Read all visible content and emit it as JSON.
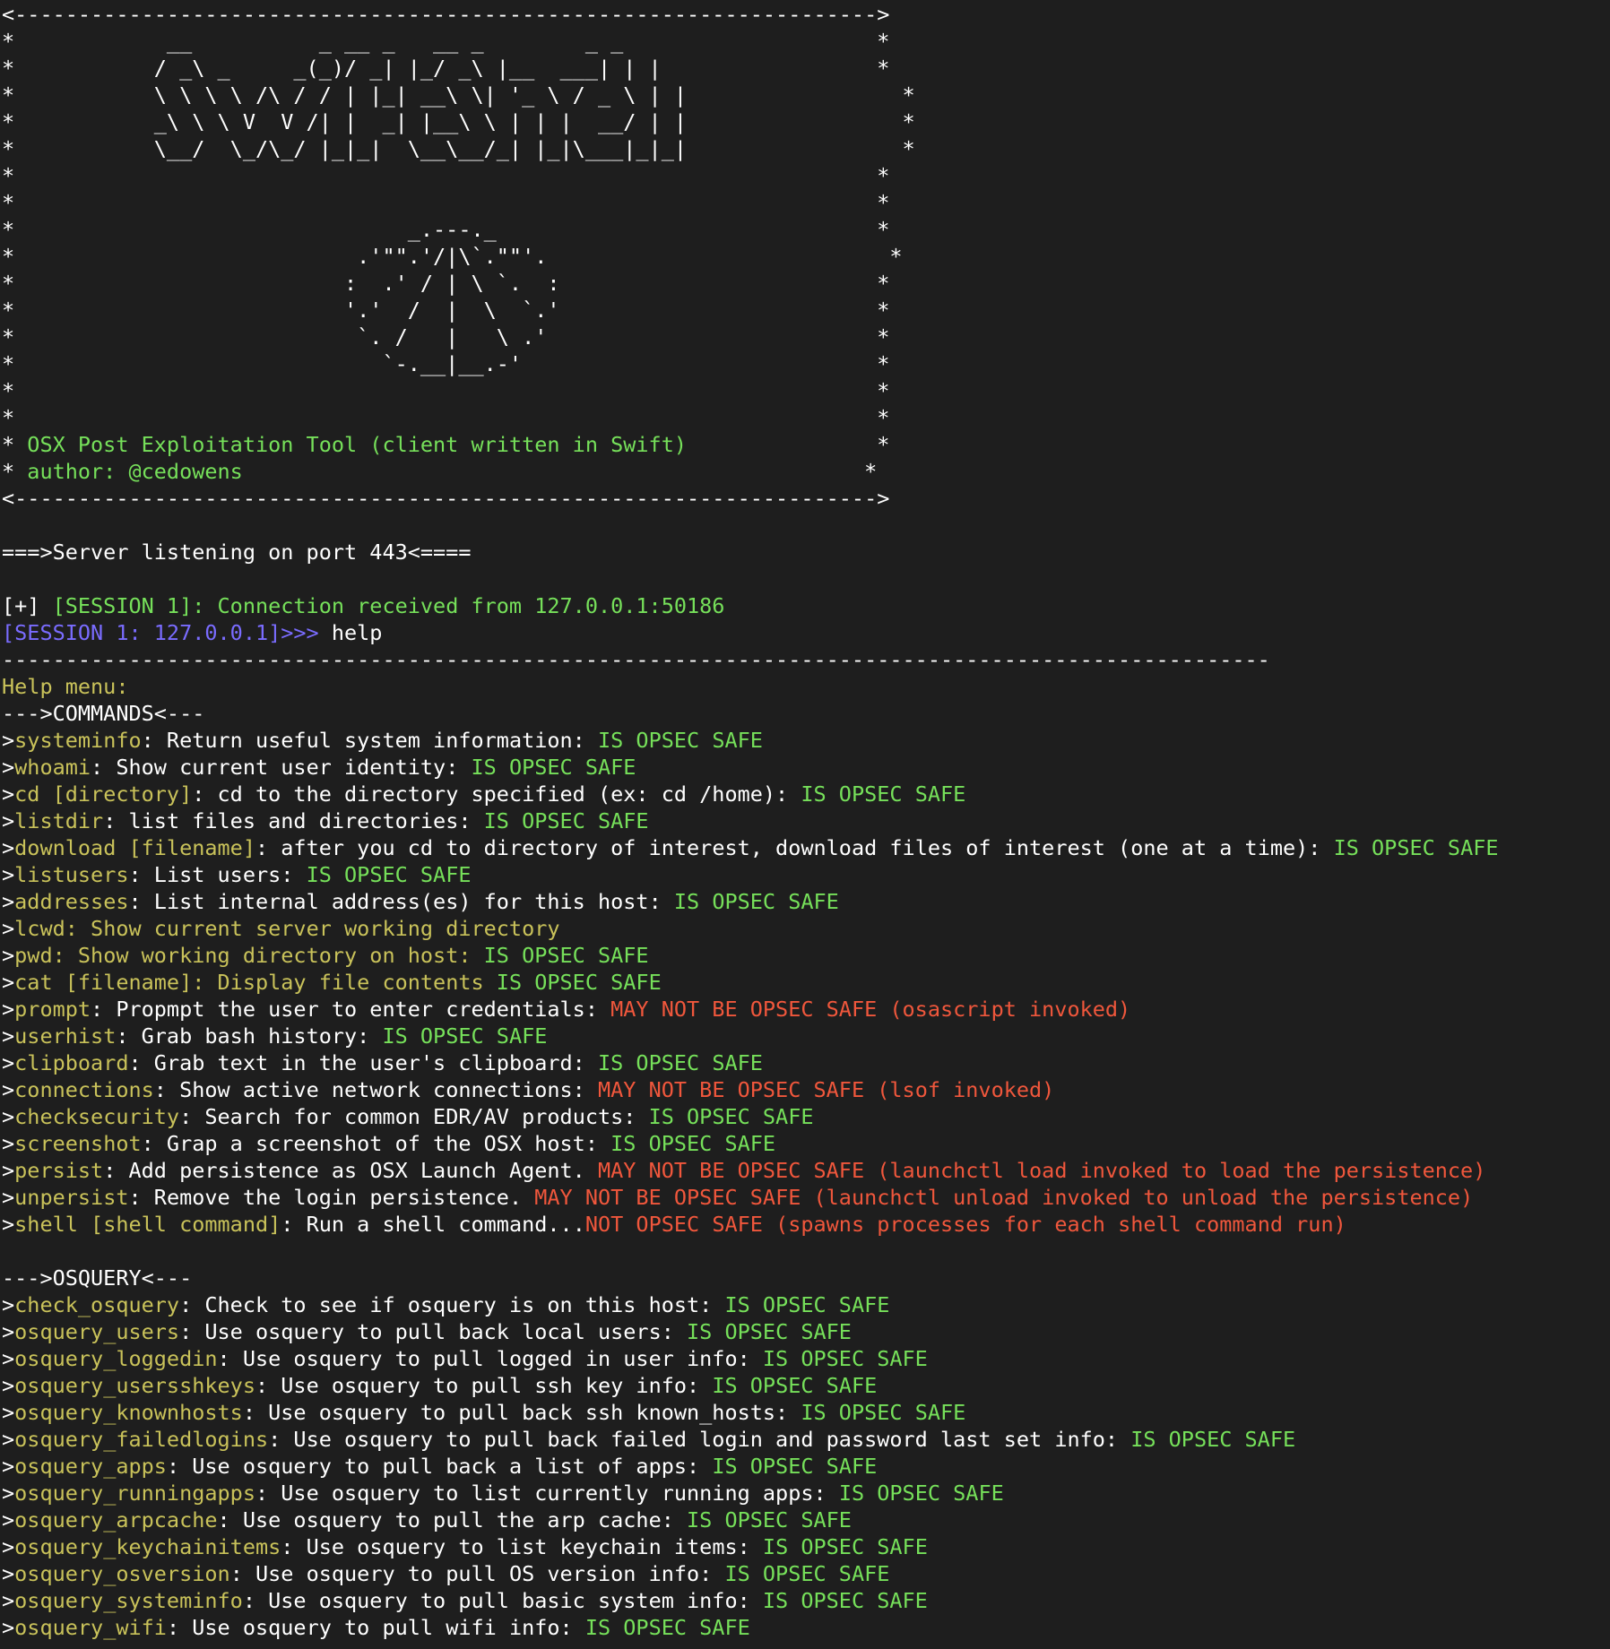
{
  "colors": {
    "background": "#1e1e1e",
    "w": "#ffffff",
    "g": "#76e05a",
    "y": "#c9c25a",
    "r": "#f0573c",
    "b": "#7a6cff"
  },
  "lines": [
    [
      [
        "w",
        "<-------------------------------------------------------------------->"
      ]
    ],
    [
      [
        "w",
        "*            __          _ __ _   __ _        _ _                    *"
      ]
    ],
    [
      [
        "w",
        "*           / _\\ _     _(_)/ _| |_/ _\\ |__  ___| | |                 *"
      ]
    ],
    [
      [
        "w",
        "*           \\ \\ \\ \\ /\\ / / | |_| __\\ \\| '_ \\ / _ \\ | |                 *"
      ]
    ],
    [
      [
        "w",
        "*           _\\ \\ \\ V  V /| |  _| |__\\ \\ | | |  __/ | |                 *"
      ]
    ],
    [
      [
        "w",
        "*           \\__/  \\_/\\_/ |_|_|  \\__\\__/_| |_|\\___|_|_|                 *"
      ]
    ],
    [
      [
        "w",
        "*                                                                    *"
      ]
    ],
    [
      [
        "w",
        "*                                                                    *"
      ]
    ],
    [
      [
        "w",
        "*                               _.---._                              *"
      ]
    ],
    [
      [
        "w",
        "*                           .'\"\".'/|\\`.\"\"'.                           *"
      ]
    ],
    [
      [
        "w",
        "*                          :  .' / | \\ `.  :                         *"
      ]
    ],
    [
      [
        "w",
        "*                          '.'  /  |  \\  `.'                         *"
      ]
    ],
    [
      [
        "w",
        "*                           `. /   |   \\ .'                          *"
      ]
    ],
    [
      [
        "w",
        "*                             `-.__|__.-'                            *"
      ]
    ],
    [
      [
        "w",
        "*                                                                    *"
      ]
    ],
    [
      [
        "w",
        "*                                                                    *"
      ]
    ],
    [
      [
        "w",
        "* "
      ],
      [
        "g",
        "OSX Post Exploitation Tool (client written in Swift)"
      ],
      [
        "w",
        "               *"
      ]
    ],
    [
      [
        "w",
        "* "
      ],
      [
        "g",
        "author: @cedowens"
      ],
      [
        "w",
        "                                                 *"
      ]
    ],
    [
      [
        "w",
        "<-------------------------------------------------------------------->"
      ]
    ],
    [
      [
        "w",
        ""
      ]
    ],
    [
      [
        "w",
        "===>Server listening on port 443<===="
      ]
    ],
    [
      [
        "w",
        ""
      ]
    ],
    [
      [
        "w",
        "[+] "
      ],
      [
        "g",
        "[SESSION 1]: Connection received from 127.0.0.1:50186"
      ]
    ],
    [
      [
        "b",
        "[SESSION 1: 127.0.0.1]>>> "
      ],
      [
        "w",
        "help"
      ]
    ],
    [
      [
        "w",
        "----------------------------------------------------------------------------------------------------"
      ]
    ],
    [
      [
        "y",
        "Help menu:"
      ]
    ],
    [
      [
        "w",
        "--->COMMANDS<---"
      ]
    ],
    [
      [
        "w",
        ">"
      ],
      [
        "y",
        "systeminfo"
      ],
      [
        "w",
        ": Return useful system information: "
      ],
      [
        "g",
        "IS OPSEC SAFE"
      ]
    ],
    [
      [
        "w",
        ">"
      ],
      [
        "y",
        "whoami"
      ],
      [
        "w",
        ": Show current user identity: "
      ],
      [
        "g",
        "IS OPSEC SAFE"
      ]
    ],
    [
      [
        "w",
        ">"
      ],
      [
        "y",
        "cd [directory]"
      ],
      [
        "w",
        ": cd to the directory specified (ex: cd /home): "
      ],
      [
        "g",
        "IS OPSEC SAFE"
      ]
    ],
    [
      [
        "w",
        ">"
      ],
      [
        "y",
        "listdir"
      ],
      [
        "w",
        ": list files and directories: "
      ],
      [
        "g",
        "IS OPSEC SAFE"
      ]
    ],
    [
      [
        "w",
        ">"
      ],
      [
        "y",
        "download [filename]"
      ],
      [
        "w",
        ": after you cd to directory of interest, download files of interest (one at a time): "
      ],
      [
        "g",
        "IS OPSEC SAFE"
      ]
    ],
    [
      [
        "w",
        ">"
      ],
      [
        "y",
        "listusers"
      ],
      [
        "w",
        ": List users: "
      ],
      [
        "g",
        "IS OPSEC SAFE"
      ]
    ],
    [
      [
        "w",
        ">"
      ],
      [
        "y",
        "addresses"
      ],
      [
        "w",
        ": List internal address(es) for this host: "
      ],
      [
        "g",
        "IS OPSEC SAFE"
      ]
    ],
    [
      [
        "w",
        ">"
      ],
      [
        "y",
        "lcwd: Show current server working directory"
      ]
    ],
    [
      [
        "w",
        ">"
      ],
      [
        "y",
        "pwd: Show working directory on host: "
      ],
      [
        "g",
        "IS OPSEC SAFE"
      ]
    ],
    [
      [
        "w",
        ">"
      ],
      [
        "y",
        "cat [filename]: Display file contents "
      ],
      [
        "g",
        "IS OPSEC SAFE"
      ]
    ],
    [
      [
        "w",
        ">"
      ],
      [
        "y",
        "prompt"
      ],
      [
        "w",
        ": Propmpt the user to enter credentials: "
      ],
      [
        "r",
        "MAY NOT BE OPSEC SAFE (osascript invoked)"
      ]
    ],
    [
      [
        "w",
        ">"
      ],
      [
        "y",
        "userhist"
      ],
      [
        "w",
        ": Grab bash history: "
      ],
      [
        "g",
        "IS OPSEC SAFE"
      ]
    ],
    [
      [
        "w",
        ">"
      ],
      [
        "y",
        "clipboard"
      ],
      [
        "w",
        ": Grab text in the user's clipboard: "
      ],
      [
        "g",
        "IS OPSEC SAFE"
      ]
    ],
    [
      [
        "w",
        ">"
      ],
      [
        "y",
        "connections"
      ],
      [
        "w",
        ": Show active network connections: "
      ],
      [
        "r",
        "MAY NOT BE OPSEC SAFE (lsof invoked)"
      ]
    ],
    [
      [
        "w",
        ">"
      ],
      [
        "y",
        "checksecurity"
      ],
      [
        "w",
        ": Search for common EDR/AV products: "
      ],
      [
        "g",
        "IS OPSEC SAFE"
      ]
    ],
    [
      [
        "w",
        ">"
      ],
      [
        "y",
        "screenshot"
      ],
      [
        "w",
        ": Grap a screenshot of the OSX host: "
      ],
      [
        "g",
        "IS OPSEC SAFE"
      ]
    ],
    [
      [
        "w",
        ">"
      ],
      [
        "y",
        "persist"
      ],
      [
        "w",
        ": Add persistence as OSX Launch Agent. "
      ],
      [
        "r",
        "MAY NOT BE OPSEC SAFE (launchctl load invoked to load the persistence)"
      ]
    ],
    [
      [
        "w",
        ">"
      ],
      [
        "y",
        "unpersist"
      ],
      [
        "w",
        ": Remove the login persistence. "
      ],
      [
        "r",
        "MAY NOT BE OPSEC SAFE (launchctl unload invoked to unload the persistence)"
      ]
    ],
    [
      [
        "w",
        ">"
      ],
      [
        "y",
        "shell [shell command]"
      ],
      [
        "w",
        ": Run a shell command..."
      ],
      [
        "r",
        "NOT OPSEC SAFE (spawns processes for each shell command run)"
      ]
    ],
    [
      [
        "w",
        ""
      ]
    ],
    [
      [
        "w",
        "--->OSQUERY<---"
      ]
    ],
    [
      [
        "w",
        ">"
      ],
      [
        "y",
        "check_osquery"
      ],
      [
        "w",
        ": Check to see if osquery is on this host: "
      ],
      [
        "g",
        "IS OPSEC SAFE"
      ]
    ],
    [
      [
        "w",
        ">"
      ],
      [
        "y",
        "osquery_users"
      ],
      [
        "w",
        ": Use osquery to pull back local users: "
      ],
      [
        "g",
        "IS OPSEC SAFE"
      ]
    ],
    [
      [
        "w",
        ">"
      ],
      [
        "y",
        "osquery_loggedin"
      ],
      [
        "w",
        ": Use osquery to pull logged in user info: "
      ],
      [
        "g",
        "IS OPSEC SAFE"
      ]
    ],
    [
      [
        "w",
        ">"
      ],
      [
        "y",
        "osquery_usersshkeys"
      ],
      [
        "w",
        ": Use osquery to pull ssh key info: "
      ],
      [
        "g",
        "IS OPSEC SAFE"
      ]
    ],
    [
      [
        "w",
        ">"
      ],
      [
        "y",
        "osquery_knownhosts"
      ],
      [
        "w",
        ": Use osquery to pull back ssh known_hosts: "
      ],
      [
        "g",
        "IS OPSEC SAFE"
      ]
    ],
    [
      [
        "w",
        ">"
      ],
      [
        "y",
        "osquery_failedlogins"
      ],
      [
        "w",
        ": Use osquery to pull back failed login and password last set info: "
      ],
      [
        "g",
        "IS OPSEC SAFE"
      ]
    ],
    [
      [
        "w",
        ">"
      ],
      [
        "y",
        "osquery_apps"
      ],
      [
        "w",
        ": Use osquery to pull back a list of apps: "
      ],
      [
        "g",
        "IS OPSEC SAFE"
      ]
    ],
    [
      [
        "w",
        ">"
      ],
      [
        "y",
        "osquery_runningapps"
      ],
      [
        "w",
        ": Use osquery to list currently running apps: "
      ],
      [
        "g",
        "IS OPSEC SAFE"
      ]
    ],
    [
      [
        "w",
        ">"
      ],
      [
        "y",
        "osquery_arpcache"
      ],
      [
        "w",
        ": Use osquery to pull the arp cache: "
      ],
      [
        "g",
        "IS OPSEC SAFE"
      ]
    ],
    [
      [
        "w",
        ">"
      ],
      [
        "y",
        "osquery_keychainitems"
      ],
      [
        "w",
        ": Use osquery to list keychain items: "
      ],
      [
        "g",
        "IS OPSEC SAFE"
      ]
    ],
    [
      [
        "w",
        ">"
      ],
      [
        "y",
        "osquery_osversion"
      ],
      [
        "w",
        ": Use osquery to pull OS version info: "
      ],
      [
        "g",
        "IS OPSEC SAFE"
      ]
    ],
    [
      [
        "w",
        ">"
      ],
      [
        "y",
        "osquery_systeminfo"
      ],
      [
        "w",
        ": Use osquery to pull basic system info: "
      ],
      [
        "g",
        "IS OPSEC SAFE"
      ]
    ],
    [
      [
        "w",
        ">"
      ],
      [
        "y",
        "osquery_wifi"
      ],
      [
        "w",
        ": Use osquery to pull wifi info: "
      ],
      [
        "g",
        "IS OPSEC SAFE"
      ]
    ]
  ]
}
